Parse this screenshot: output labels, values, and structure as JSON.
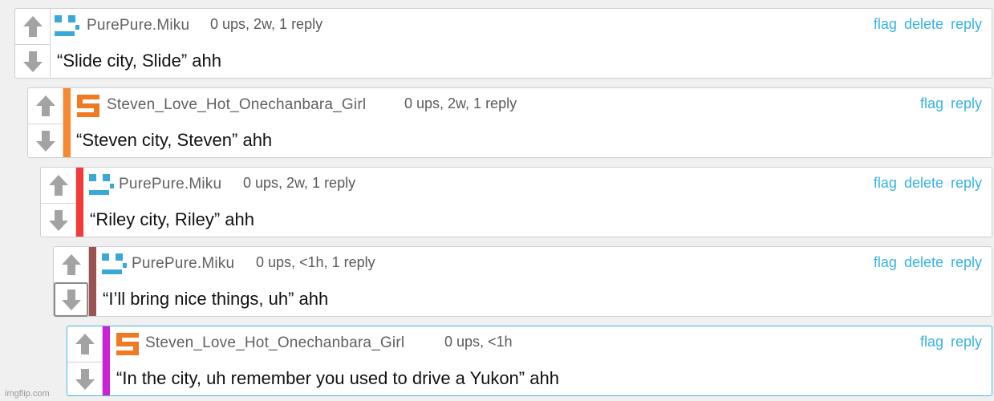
{
  "comments": [
    {
      "user": "PurePure.Miku",
      "meta": "0 ups, 2w, 1 reply",
      "text": "“Slide city, Slide” ahh",
      "avatar": "miku-icon",
      "bar_color": "",
      "actions": [
        "flag",
        "delete",
        "reply"
      ]
    },
    {
      "user": "Steven_Love_Hot_Onechanbara_Girl",
      "meta": "0 ups, 2w, 1 reply",
      "text": "“Steven city, Steven” ahh",
      "avatar": "steven-s-icon",
      "bar_color": "#f7882f",
      "actions": [
        "flag",
        "reply"
      ]
    },
    {
      "user": "PurePure.Miku",
      "meta": "0 ups, 2w, 1 reply",
      "text": "“Riley city, Riley” ahh",
      "avatar": "miku-icon",
      "bar_color": "#f23a3a",
      "actions": [
        "flag",
        "delete",
        "reply"
      ]
    },
    {
      "user": "PurePure.Miku",
      "meta": "0 ups, <1h, 1 reply",
      "text": "“I’ll bring nice things, uh” ahh",
      "avatar": "miku-icon",
      "bar_color": "#9c5252",
      "actions": [
        "flag",
        "delete",
        "reply"
      ]
    },
    {
      "user": "Steven_Love_Hot_Onechanbara_Girl",
      "meta": "0 ups, <1h",
      "text": "“In the city, uh remember you used to drive a Yukon” ahh",
      "avatar": "steven-s-icon",
      "bar_color": "#cc22d6",
      "actions": [
        "flag",
        "reply"
      ]
    }
  ],
  "watermark": "imgflip.com"
}
